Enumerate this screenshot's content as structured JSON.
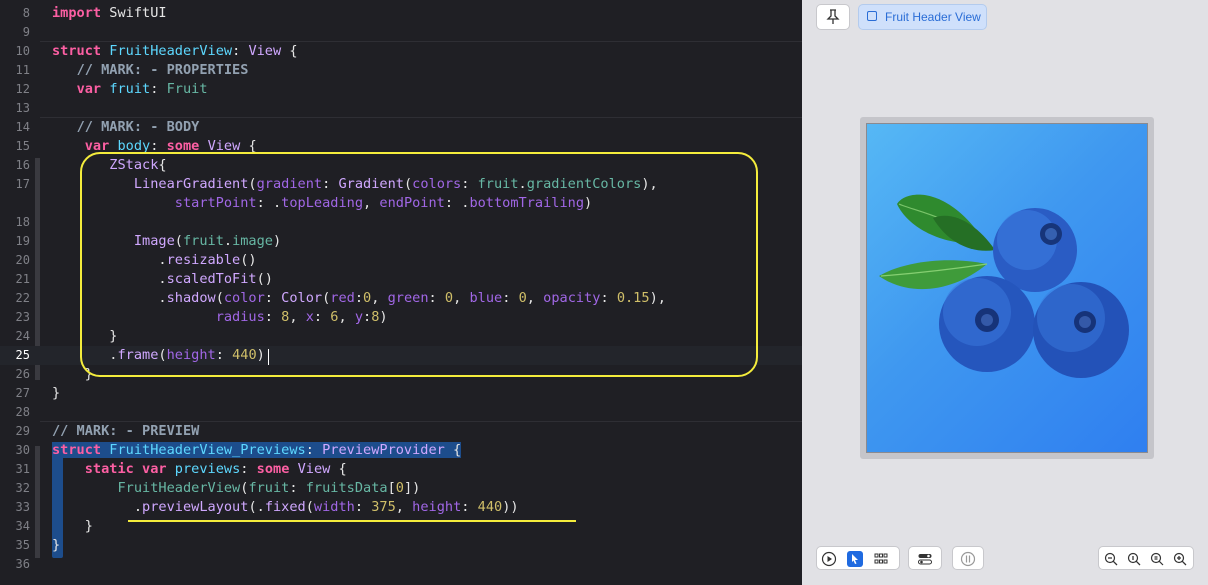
{
  "editor": {
    "lines": [
      {
        "n": "8",
        "segs": [
          [
            "kw",
            "import"
          ],
          [
            "pl",
            " SwiftUI"
          ]
        ]
      },
      {
        "n": "9",
        "segs": []
      },
      {
        "n": "10",
        "segs": [
          [
            "kw",
            "struct"
          ],
          [
            "pl",
            " "
          ],
          [
            "typ",
            "FruitHeaderView"
          ],
          [
            "pl",
            ": "
          ],
          [
            "lib",
            "View"
          ],
          [
            "pl",
            " {"
          ]
        ]
      },
      {
        "n": "11",
        "segs": [
          [
            "pl",
            "   "
          ],
          [
            "mark",
            "// MARK: - PROPERTIES"
          ]
        ]
      },
      {
        "n": "12",
        "segs": [
          [
            "pl",
            "   "
          ],
          [
            "kw",
            "var"
          ],
          [
            "pl",
            " "
          ],
          [
            "typ",
            "fruit"
          ],
          [
            "pl",
            ": "
          ],
          [
            "fn",
            "Fruit"
          ]
        ]
      },
      {
        "n": "13",
        "segs": []
      },
      {
        "n": "14",
        "segs": [
          [
            "pl",
            "   "
          ],
          [
            "mark",
            "// MARK: - BODY"
          ]
        ]
      },
      {
        "n": "15",
        "segs": [
          [
            "pl",
            "    "
          ],
          [
            "kw",
            "var"
          ],
          [
            "pl",
            " "
          ],
          [
            "typ",
            "body"
          ],
          [
            "pl",
            ": "
          ],
          [
            "kw",
            "some"
          ],
          [
            "pl",
            " "
          ],
          [
            "lib",
            "View"
          ],
          [
            "pl",
            " {"
          ]
        ]
      },
      {
        "n": "16",
        "segs": [
          [
            "pl",
            "       "
          ],
          [
            "lib",
            "ZStack"
          ],
          [
            "pl",
            "{"
          ]
        ]
      },
      {
        "n": "17",
        "segs": [
          [
            "pl",
            "          "
          ],
          [
            "lib",
            "LinearGradient"
          ],
          [
            "pl",
            "("
          ],
          [
            "prop",
            "gradient"
          ],
          [
            "pl",
            ": "
          ],
          [
            "lib",
            "Gradient"
          ],
          [
            "pl",
            "("
          ],
          [
            "prop",
            "colors"
          ],
          [
            "pl",
            ": "
          ],
          [
            "fn",
            "fruit"
          ],
          [
            "pl",
            "."
          ],
          [
            "fn",
            "gradientColors"
          ],
          [
            "pl",
            "),"
          ]
        ]
      },
      {
        "n": "",
        "segs": [
          [
            "pl",
            "               "
          ],
          [
            "prop",
            "startPoint"
          ],
          [
            "pl",
            ": ."
          ],
          [
            "prop",
            "topLeading"
          ],
          [
            "pl",
            ", "
          ],
          [
            "prop",
            "endPoint"
          ],
          [
            "pl",
            ": ."
          ],
          [
            "prop",
            "bottomTrailing"
          ],
          [
            "pl",
            ")"
          ]
        ]
      },
      {
        "n": "18",
        "segs": []
      },
      {
        "n": "19",
        "segs": [
          [
            "pl",
            "          "
          ],
          [
            "lib",
            "Image"
          ],
          [
            "pl",
            "("
          ],
          [
            "fn",
            "fruit"
          ],
          [
            "pl",
            "."
          ],
          [
            "fn",
            "image"
          ],
          [
            "pl",
            ")"
          ]
        ]
      },
      {
        "n": "20",
        "segs": [
          [
            "pl",
            "             ."
          ],
          [
            "lib",
            "resizable"
          ],
          [
            "pl",
            "()"
          ]
        ]
      },
      {
        "n": "21",
        "segs": [
          [
            "pl",
            "             ."
          ],
          [
            "lib",
            "scaledToFit"
          ],
          [
            "pl",
            "()"
          ]
        ]
      },
      {
        "n": "22",
        "segs": [
          [
            "pl",
            "             ."
          ],
          [
            "lib",
            "shadow"
          ],
          [
            "pl",
            "("
          ],
          [
            "prop",
            "color"
          ],
          [
            "pl",
            ": "
          ],
          [
            "lib",
            "Color"
          ],
          [
            "pl",
            "("
          ],
          [
            "prop",
            "red"
          ],
          [
            "pl",
            ":"
          ],
          [
            "num",
            "0"
          ],
          [
            "pl",
            ", "
          ],
          [
            "prop",
            "green"
          ],
          [
            "pl",
            ": "
          ],
          [
            "num",
            "0"
          ],
          [
            "pl",
            ", "
          ],
          [
            "prop",
            "blue"
          ],
          [
            "pl",
            ": "
          ],
          [
            "num",
            "0"
          ],
          [
            "pl",
            ", "
          ],
          [
            "prop",
            "opacity"
          ],
          [
            "pl",
            ": "
          ],
          [
            "num",
            "0.15"
          ],
          [
            "pl",
            "),"
          ]
        ]
      },
      {
        "n": "23",
        "segs": [
          [
            "pl",
            "                    "
          ],
          [
            "prop",
            "radius"
          ],
          [
            "pl",
            ": "
          ],
          [
            "num",
            "8"
          ],
          [
            "pl",
            ", "
          ],
          [
            "prop",
            "x"
          ],
          [
            "pl",
            ": "
          ],
          [
            "num",
            "6"
          ],
          [
            "pl",
            ", "
          ],
          [
            "prop",
            "y"
          ],
          [
            "pl",
            ":"
          ],
          [
            "num",
            "8"
          ],
          [
            "pl",
            ")"
          ]
        ]
      },
      {
        "n": "24",
        "segs": [
          [
            "pl",
            "       }"
          ]
        ]
      },
      {
        "n": "25",
        "segs": [
          [
            "pl",
            "       ."
          ],
          [
            "lib",
            "frame"
          ],
          [
            "pl",
            "("
          ],
          [
            "prop",
            "height"
          ],
          [
            "pl",
            ": "
          ],
          [
            "num",
            "440"
          ],
          [
            "pl",
            ")"
          ]
        ]
      },
      {
        "n": "26",
        "segs": [
          [
            "pl",
            "    }"
          ]
        ]
      },
      {
        "n": "27",
        "segs": [
          [
            "pl",
            "}"
          ]
        ]
      },
      {
        "n": "28",
        "segs": []
      },
      {
        "n": "29",
        "segs": [
          [
            "mark",
            "// MARK: - PREVIEW"
          ]
        ]
      },
      {
        "n": "30",
        "segs": [
          [
            "kw hl",
            "struct"
          ],
          [
            "pl hl",
            " "
          ],
          [
            "typ hl",
            "FruitHeaderView_Previews"
          ],
          [
            "pl hl",
            ": "
          ],
          [
            "lib hl",
            "PreviewProvider"
          ],
          [
            "pl hl",
            " {"
          ]
        ]
      },
      {
        "n": "31",
        "segs": [
          [
            "pl",
            "    "
          ],
          [
            "kw",
            "static"
          ],
          [
            "pl",
            " "
          ],
          [
            "kw",
            "var"
          ],
          [
            "pl",
            " "
          ],
          [
            "typ",
            "previews"
          ],
          [
            "pl",
            ": "
          ],
          [
            "kw",
            "some"
          ],
          [
            "pl",
            " "
          ],
          [
            "lib",
            "View"
          ],
          [
            "pl",
            " {"
          ]
        ]
      },
      {
        "n": "32",
        "segs": [
          [
            "pl",
            "        "
          ],
          [
            "fn",
            "FruitHeaderView"
          ],
          [
            "pl",
            "("
          ],
          [
            "fn",
            "fruit"
          ],
          [
            "pl",
            ": "
          ],
          [
            "fn",
            "fruitsData"
          ],
          [
            "pl",
            "["
          ],
          [
            "num",
            "0"
          ],
          [
            "pl",
            "])"
          ]
        ]
      },
      {
        "n": "33",
        "segs": [
          [
            "pl",
            "          ."
          ],
          [
            "lib",
            "previewLayout"
          ],
          [
            "pl",
            "(."
          ],
          [
            "lib",
            "fixed"
          ],
          [
            "pl",
            "("
          ],
          [
            "prop",
            "width"
          ],
          [
            "pl",
            ": "
          ],
          [
            "num",
            "375"
          ],
          [
            "pl",
            ", "
          ],
          [
            "prop",
            "height"
          ],
          [
            "pl",
            ": "
          ],
          [
            "num",
            "440"
          ],
          [
            "pl",
            "))"
          ]
        ]
      },
      {
        "n": "34",
        "segs": [
          [
            "pl",
            "    }"
          ]
        ]
      },
      {
        "n": "35",
        "segs": [
          [
            "pl hl",
            "}"
          ]
        ]
      },
      {
        "n": "36",
        "segs": []
      }
    ],
    "current_line": "25"
  },
  "canvas": {
    "pin_icon": "pin-icon",
    "tab_label": "Fruit Header View",
    "preview_gradient": [
      "#56b8f5",
      "#2f7ff0"
    ],
    "toolbar": {
      "left": [
        "play-icon",
        "cursor-select-icon",
        "grid-icon"
      ],
      "variants": "device-settings-icon",
      "inspect": "inspect-icon",
      "zoom": [
        "zoom-out-icon",
        "zoom-fit-icon",
        "zoom-actual-icon",
        "zoom-in-icon"
      ]
    }
  }
}
